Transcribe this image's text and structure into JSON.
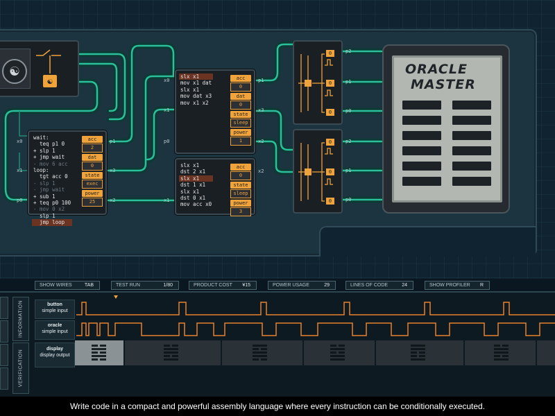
{
  "oracle": {
    "title_line1": "ORACLE",
    "title_line2": "MASTER"
  },
  "chips": {
    "a": {
      "code": [
        "wait:",
        "  teq p1 0",
        "+ slp 1",
        "+ jmp wait",
        "- mov 6 acc",
        "loop:",
        "  tgt acc 0",
        "- slp 1",
        "- jmp wait",
        "+ sub 1",
        "+ teq p0 100",
        "- mov 0 x2",
        "  slp 1",
        "  jmp loop"
      ],
      "regs": [
        {
          "label": "acc",
          "value": "2"
        },
        {
          "label": "dat",
          "value": "0"
        },
        {
          "label": "state",
          "value": "exec"
        },
        {
          "label": "power",
          "value": "25"
        }
      ],
      "pins_left": [
        "x0",
        "x1",
        "p0"
      ],
      "pins_right": [
        "p1",
        "x3",
        "x2"
      ]
    },
    "b": {
      "code": [
        "slx x1",
        "mov x1 dat",
        "slx x1",
        "mov dat x3",
        "mov x1 x2"
      ],
      "regs": [
        {
          "label": "acc",
          "value": "0"
        },
        {
          "label": "dat",
          "value": "0"
        },
        {
          "label": "state",
          "value": "sleep"
        },
        {
          "label": "power",
          "value": "1"
        }
      ],
      "pins_left": [
        "x0",
        "x1",
        "p0"
      ],
      "pins_right": [
        "p1",
        "x3",
        "x2"
      ]
    },
    "c": {
      "code": [
        "slx x1",
        "dst 2 x1",
        "slx x1",
        "dst 1 x1",
        "slx x1",
        "dst 0 x1",
        "mov acc x0"
      ],
      "regs": [
        {
          "label": "acc",
          "value": "0"
        },
        {
          "label": "state",
          "value": "sleep"
        },
        {
          "label": "power",
          "value": "3"
        }
      ],
      "pins_left": [
        "x1"
      ],
      "pins_right": [
        "x2"
      ]
    }
  },
  "mux": {
    "top": {
      "values": [
        "0",
        "0",
        "0"
      ],
      "pins": [
        "p2",
        "p1",
        "p0"
      ]
    },
    "bottom": {
      "values": [
        "0",
        "0",
        "0"
      ],
      "pins": [
        "p2",
        "p1",
        "p0"
      ]
    }
  },
  "status": {
    "show_wires": {
      "label": "SHOW WIRES",
      "value": "TAB"
    },
    "test_run": {
      "label": "TEST RUN",
      "value": "1/80"
    },
    "product_cost": {
      "label": "PRODUCT COST",
      "value": "¥15"
    },
    "power_usage": {
      "label": "POWER USAGE",
      "value": "29"
    },
    "lines_of_code": {
      "label": "LINES OF CODE",
      "value": "24"
    },
    "show_profiler": {
      "label": "SHOW PROFILER",
      "value": "R"
    }
  },
  "panel": {
    "tab_information": "INFORMATION",
    "tab_verification": "VERIFICATION",
    "rows": [
      {
        "name": "button",
        "type": "simple input"
      },
      {
        "name": "oracle",
        "type": "simple input"
      },
      {
        "name": "display",
        "type": "display output"
      }
    ]
  },
  "caption": "Write code in a compact and powerful assembly language where every instruction can be conditionally executed.",
  "colors": {
    "accent": "#f0a33a",
    "wire": "#2bbf9c",
    "board": "#1c3440",
    "trace": "#e8822a"
  }
}
